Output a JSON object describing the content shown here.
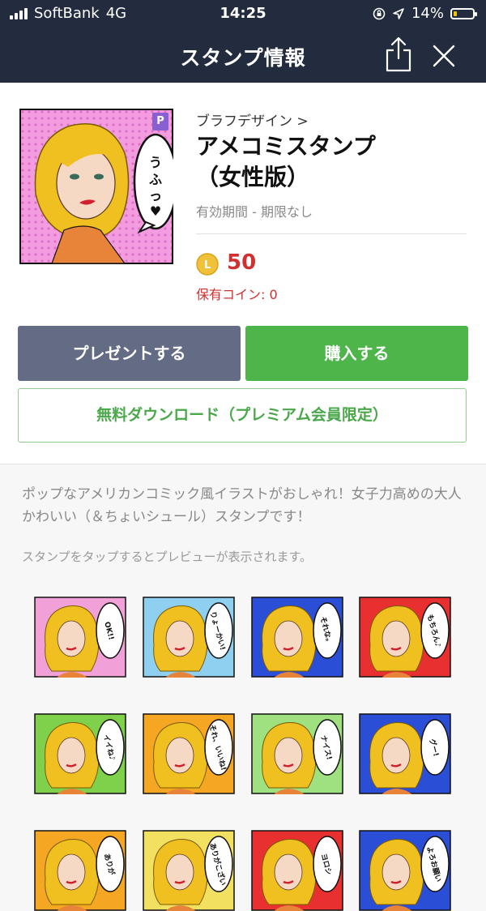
{
  "status_bar": {
    "carrier": "SoftBank",
    "network": "4G",
    "time": "14:25",
    "battery": "14%",
    "battery_level": 0.14
  },
  "navbar": {
    "title": "スタンプ情報",
    "icons": [
      "share-icon",
      "close-icon"
    ]
  },
  "sticker": {
    "creator": "ブラフデザイン >",
    "title_line1": "アメコミスタンプ",
    "title_line2": "（女性版）",
    "validity": "有効期間 - 期限なし",
    "price": "50",
    "coin_letter": "L",
    "owned_coins": "保有コイン: 0",
    "premium_badge": "P",
    "thumbnail_bubble": "うふっ♥"
  },
  "buttons": {
    "gift": "プレゼントする",
    "buy": "購入する",
    "free_download": "無料ダウンロード（プレミアム会員限定）"
  },
  "description": "ポップなアメリカンコミック風イラストがおしゃれ！女子力高めの大人かわいい（＆ちょいシュール）スタンプです！",
  "preview_hint": "スタンプをタップするとプレビューが表示されます。",
  "stickers": [
    {
      "bubble": "OK!!",
      "bg": "#f2a0d8"
    },
    {
      "bubble": "りょーかい!",
      "bg": "#8fd0f0"
    },
    {
      "bubble": "それな。",
      "bg": "#2a4fd6"
    },
    {
      "bubble": "もちろん♪",
      "bg": "#e83030"
    },
    {
      "bubble": "イイね♪",
      "bg": "#7fd04a"
    },
    {
      "bubble": "それ、いいね!",
      "bg": "#f5a623"
    },
    {
      "bubble": "ナイス!",
      "bg": "#9fe080"
    },
    {
      "bubble": "グー!",
      "bg": "#2a4fd6"
    },
    {
      "bubble": "ありが",
      "bg": "#f5a623"
    },
    {
      "bubble": "ありがこざい",
      "bg": "#f2e060"
    },
    {
      "bubble": "ヨロシ",
      "bg": "#e83030"
    },
    {
      "bubble": "よろお願い",
      "bg": "#2a4fd6"
    }
  ],
  "colors": {
    "header": "#232b3e",
    "gift_button": "#646c85",
    "buy_button": "#4db54a",
    "price": "#d03030"
  }
}
